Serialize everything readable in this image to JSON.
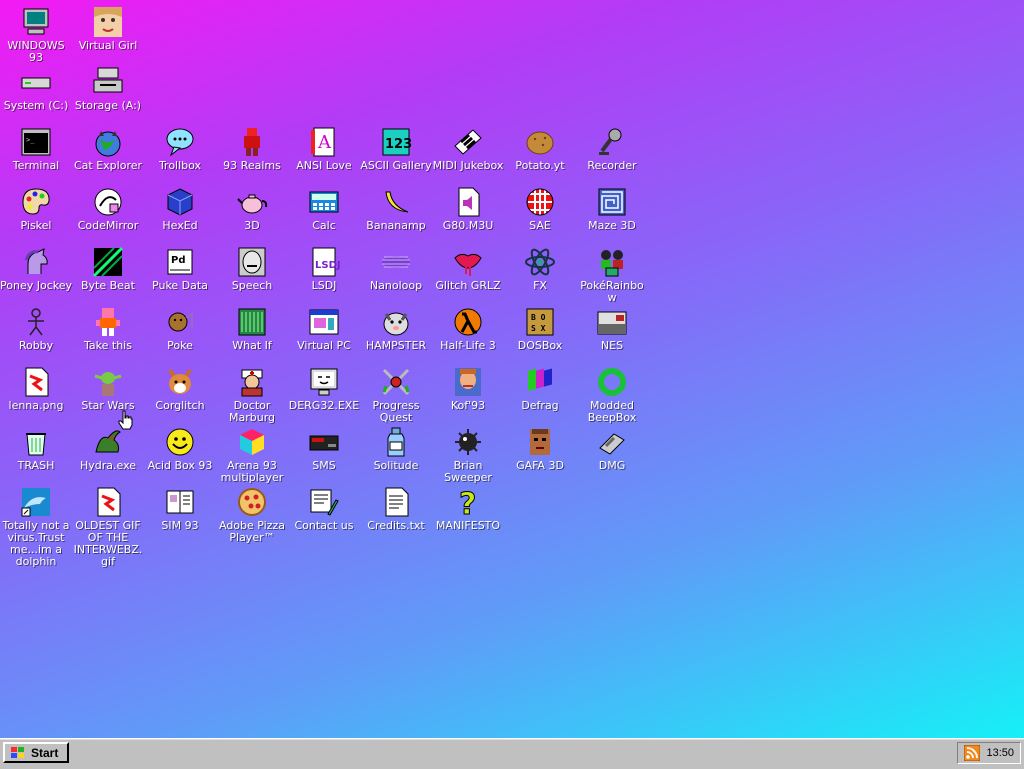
{
  "desktop": {
    "background_colors": [
      "#f41af4",
      "#b23cf6",
      "#8a64f8",
      "#5f9cf8",
      "#16f0f7"
    ],
    "icons": [
      {
        "label": "WINDOWS 93",
        "icon": "computer-icon"
      },
      {
        "label": "Virtual Girl",
        "icon": "girl-face-icon"
      },
      {
        "label": "System (C:)",
        "icon": "hard-drive-icon"
      },
      {
        "label": "Storage (A:)",
        "icon": "floppy-drive-icon"
      },
      {
        "label": "Terminal",
        "icon": "terminal-icon"
      },
      {
        "label": "Cat Explorer",
        "icon": "cat-globe-icon"
      },
      {
        "label": "Trollbox",
        "icon": "chat-bubble-icon"
      },
      {
        "label": "93 Realms",
        "icon": "realms-icon"
      },
      {
        "label": "ANSI Love",
        "icon": "ansi-letter-icon"
      },
      {
        "label": "ASCII Gallery",
        "icon": "ascii-gallery-icon"
      },
      {
        "label": "MIDI Jukebox",
        "icon": "piano-icon"
      },
      {
        "label": "Potato.yt",
        "icon": "potato-icon"
      },
      {
        "label": "Recorder",
        "icon": "microphone-icon"
      },
      {
        "label": "Piskel",
        "icon": "palette-icon"
      },
      {
        "label": "CodeMirror",
        "icon": "codemirror-icon"
      },
      {
        "label": "HexEd",
        "icon": "cube-icon"
      },
      {
        "label": "3D",
        "icon": "teapot-icon"
      },
      {
        "label": "Calc",
        "icon": "calculator-icon"
      },
      {
        "label": "Bananamp",
        "icon": "banana-icon"
      },
      {
        "label": "G80.M3U",
        "icon": "audio-file-icon"
      },
      {
        "label": "SAE",
        "icon": "amiga-ball-icon"
      },
      {
        "label": "Maze 3D",
        "icon": "maze-icon"
      },
      {
        "label": "Poney Jockey",
        "icon": "pony-icon"
      },
      {
        "label": "Byte Beat",
        "icon": "bytebeat-icon"
      },
      {
        "label": "Puke Data",
        "icon": "puredata-icon"
      },
      {
        "label": "Speech",
        "icon": "speech-face-icon"
      },
      {
        "label": "LSDJ",
        "icon": "lsdj-icon"
      },
      {
        "label": "Nanoloop",
        "icon": "nanoloop-icon"
      },
      {
        "label": "Glitch GRLZ",
        "icon": "lips-icon"
      },
      {
        "label": "FX",
        "icon": "atom-icon"
      },
      {
        "label": "PokéRainbow",
        "icon": "pokerainbow-icon"
      },
      {
        "label": "Robby",
        "icon": "stick-figure-icon"
      },
      {
        "label": "Take this",
        "icon": "pixel-character-icon"
      },
      {
        "label": "Poke",
        "icon": "pokemon-icon"
      },
      {
        "label": "What If",
        "icon": "whatif-icon"
      },
      {
        "label": "Virtual PC",
        "icon": "window-app-icon"
      },
      {
        "label": "HAMPSTER",
        "icon": "hamster-icon"
      },
      {
        "label": "Half-Life 3",
        "icon": "lambda-icon"
      },
      {
        "label": "DOSBox",
        "icon": "dosbox-icon"
      },
      {
        "label": "NES",
        "icon": "nes-console-icon"
      },
      {
        "label": "lenna.png",
        "icon": "image-file-icon"
      },
      {
        "label": "Star Wars",
        "icon": "yoda-icon"
      },
      {
        "label": "Corglitch",
        "icon": "corgi-icon"
      },
      {
        "label": "Doctor Marburg",
        "icon": "doctor-icon"
      },
      {
        "label": "DERG32.EXE",
        "icon": "derg-monitor-icon"
      },
      {
        "label": "Progress Quest",
        "icon": "crossed-swords-icon"
      },
      {
        "label": "Kof'93",
        "icon": "fighter-icon"
      },
      {
        "label": "Defrag",
        "icon": "defrag-icon"
      },
      {
        "label": "Modded BeepBox",
        "icon": "green-ring-icon"
      },
      {
        "label": "TRASH",
        "icon": "trash-icon"
      },
      {
        "label": "Hydra.exe",
        "icon": "hydra-icon"
      },
      {
        "label": "Acid Box 93",
        "icon": "smiley-icon"
      },
      {
        "label": "Arena 93 multiplayer",
        "icon": "colored-cube-icon"
      },
      {
        "label": "SMS",
        "icon": "sms-console-icon"
      },
      {
        "label": "Solitude",
        "icon": "bottle-icon"
      },
      {
        "label": "Brian Sweeper",
        "icon": "mine-icon"
      },
      {
        "label": "GAFA 3D",
        "icon": "doom-face-icon"
      },
      {
        "label": "DMG",
        "icon": "gameboy-cart-icon"
      },
      {
        "label": "Totally not a virus.Trust me...im a dolphin",
        "icon": "dolphin-icon"
      },
      {
        "label": "OLDEST GIF OF THE INTERWEBZ.gif",
        "icon": "gif-file-icon"
      },
      {
        "label": "SIM 93",
        "icon": "book-icon"
      },
      {
        "label": "Adobe Pizza Player™",
        "icon": "pizza-icon"
      },
      {
        "label": "Contact us",
        "icon": "contact-icon"
      },
      {
        "label": "Credits.txt",
        "icon": "text-file-icon"
      },
      {
        "label": "MANIFESTO",
        "icon": "question-mark-icon"
      }
    ]
  },
  "taskbar": {
    "start_label": "Start",
    "clock": "13:50"
  }
}
